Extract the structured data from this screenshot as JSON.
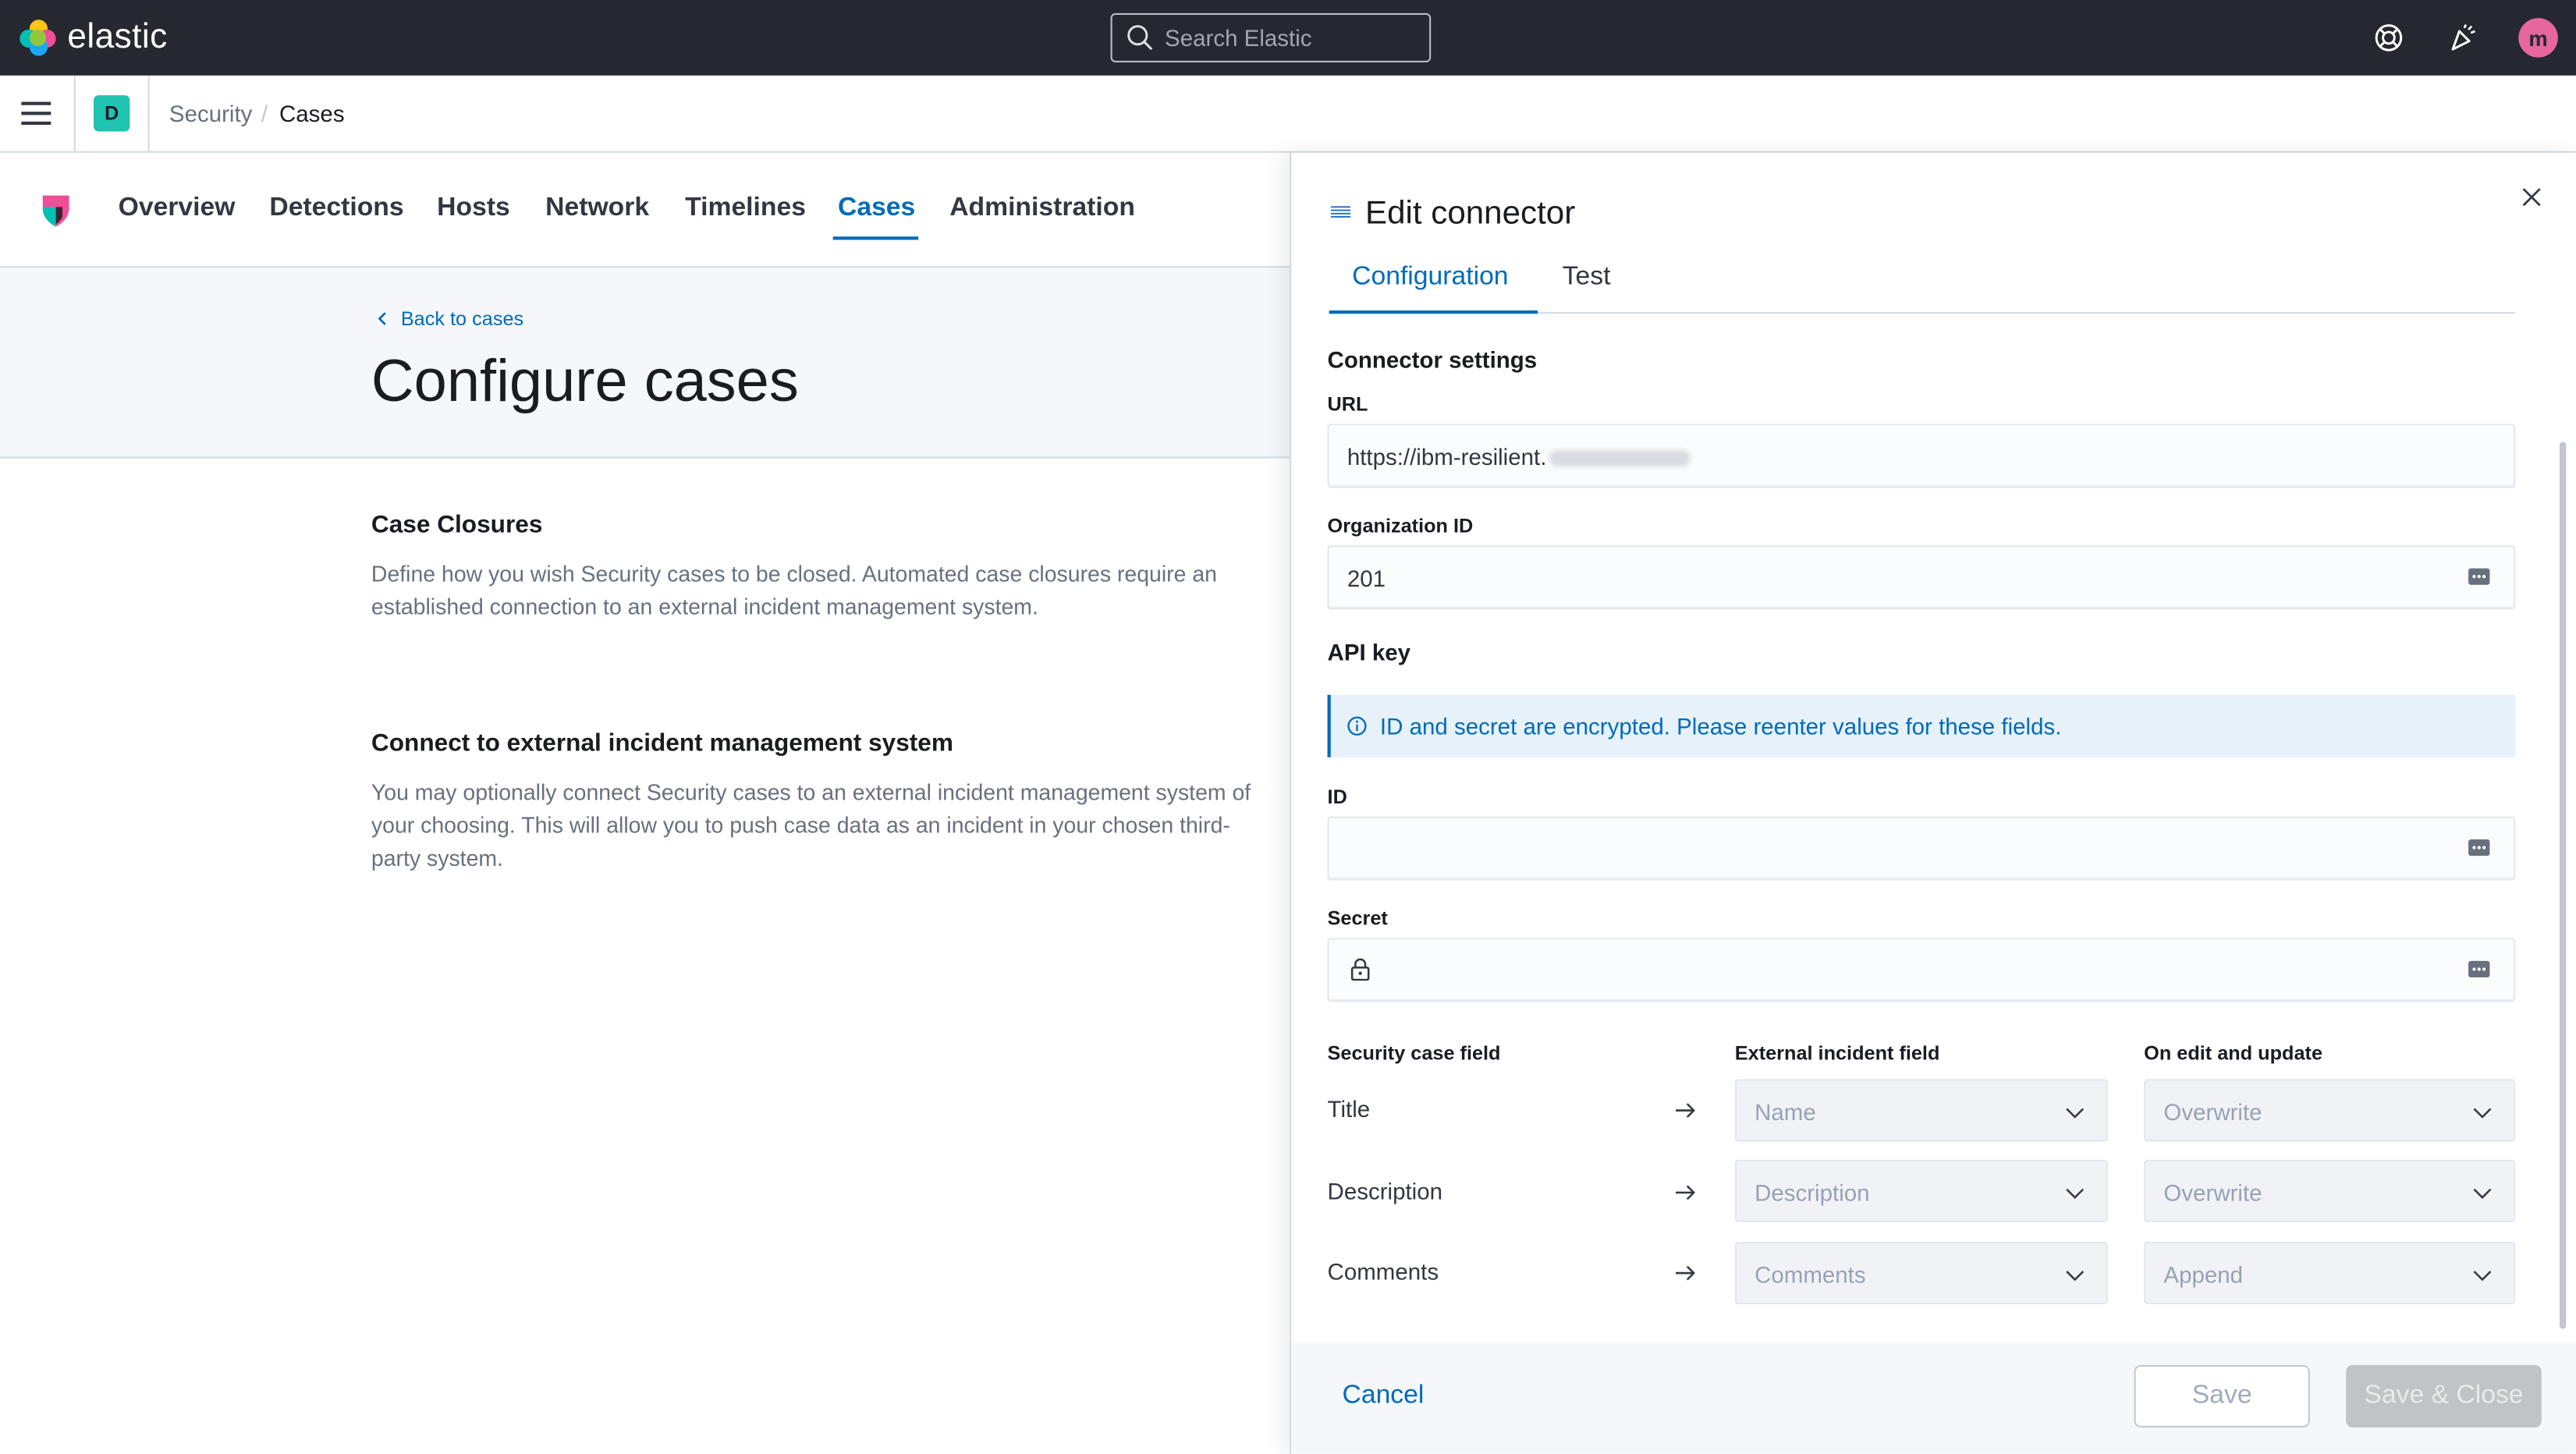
{
  "header": {
    "brand": "elastic",
    "search_placeholder": "Search Elastic",
    "avatar_initial": "m"
  },
  "breadcrumb": {
    "space_badge": "D",
    "items": [
      "Security",
      "/",
      "Cases"
    ]
  },
  "app_tabs": [
    {
      "label": "Overview",
      "active": false
    },
    {
      "label": "Detections",
      "active": false
    },
    {
      "label": "Hosts",
      "active": false
    },
    {
      "label": "Network",
      "active": false
    },
    {
      "label": "Timelines",
      "active": false
    },
    {
      "label": "Cases",
      "active": true
    },
    {
      "label": "Administration",
      "active": false
    }
  ],
  "page": {
    "back_link": "Back to cases",
    "title": "Configure cases",
    "sections": [
      {
        "title": "Case Closures",
        "description": "Define how you wish Security cases to be closed. Automated case closures require an established connection to an external incident management system."
      },
      {
        "title": "Connect to external incident management system",
        "description": "You may optionally connect Security cases to an external incident management system of your choosing. This will allow you to push case data as an incident in your chosen third-party system."
      }
    ]
  },
  "flyout": {
    "title": "Edit connector",
    "tabs": [
      {
        "label": "Configuration",
        "active": true
      },
      {
        "label": "Test",
        "active": false
      }
    ],
    "connector_settings": "Connector settings",
    "url_label": "URL",
    "url_value": "https://ibm-resilient.",
    "org_label": "Organization ID",
    "org_value": "201",
    "api_key_heading": "API key",
    "callout": "ID and secret are encrypted. Please reenter values for these fields.",
    "id_label": "ID",
    "id_value": "",
    "secret_label": "Secret",
    "secret_value": "",
    "mapping": {
      "headers": [
        "Security case field",
        "External incident field",
        "On edit and update"
      ],
      "rows": [
        {
          "field": "Title",
          "external": "Name",
          "action": "Overwrite"
        },
        {
          "field": "Description",
          "external": "Description",
          "action": "Overwrite"
        },
        {
          "field": "Comments",
          "external": "Comments",
          "action": "Append"
        }
      ]
    },
    "footer": {
      "cancel": "Cancel",
      "save": "Save",
      "save_close": "Save & Close"
    }
  },
  "colors": {
    "accent": "#006bb8",
    "header_bg": "#25282f",
    "space_badge": "#20c2b0",
    "avatar": "#e7669c"
  }
}
